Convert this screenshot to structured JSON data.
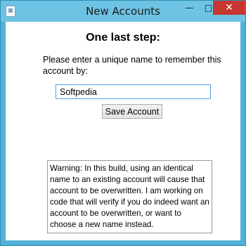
{
  "window": {
    "title": "New Accounts",
    "minimize": "—",
    "maximize": "□",
    "close": "✕",
    "app_icon": "app-icon"
  },
  "content": {
    "heading": "One last step:",
    "prompt": "Please enter a unique name to remember this account by:",
    "name_value": "Softpedia",
    "save_label": "Save Account",
    "warning": "Warning: In this build, using an identical name to an existing account will cause that account to be overwritten. I am working on code that will verify if you do indeed want an account to be overwritten, or want to choose a new name instead."
  },
  "colors": {
    "accent": "#52b0d6",
    "close": "#c7372f",
    "input_border": "#569de5"
  }
}
